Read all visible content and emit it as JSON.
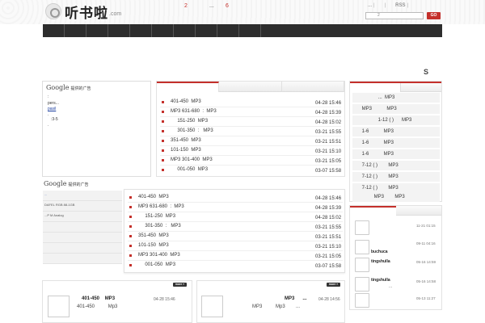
{
  "header": {
    "logo_text": "听书啦",
    "logo_sub": ".com",
    "num_a": "2",
    "dots": "...",
    "num_b": "6",
    "toplinks": [
      "...",
      "|",
      "|",
      "RSS",
      "|"
    ],
    "search_placeholder": "2",
    "search_btn": "GO"
  },
  "s_mark": "S",
  "ad1": {
    "brand": "Google",
    "title": "提供的广告",
    "lines": [
      ":",
      "pers...",
      "pasil",
      ".",
      ":3-5",
      "."
    ]
  },
  "ad2": {
    "brand": "Google",
    "title": "提供的广告",
    "bars": [
      "...",
      "DAFEL RGB 88-1GB",
      "...P M Analog",
      "",
      "",
      "",
      ""
    ]
  },
  "main_list": {
    "rows": [
      {
        "text": "401-450  MP3",
        "date": "04-28 15:46"
      },
      {
        "text": "MP3 631-680  :  MP3",
        "date": "04-28 15:39"
      },
      {
        "text": "     151-250  MP3",
        "date": "04-28 15:02"
      },
      {
        "text": "     301-350  :   MP3",
        "date": "03-21 15:55"
      },
      {
        "text": "351-450  MP3",
        "date": "03-21 15:51"
      },
      {
        "text": "101-150  MP3",
        "date": "03-21 15:10"
      },
      {
        "text": "MP3 301-400  MP3",
        "date": "03-21 15:05"
      },
      {
        "text": "     001-050  MP3",
        "date": "03-07 15:58"
      }
    ]
  },
  "second_list": {
    "rows": [
      {
        "text": "401-450  MP3",
        "date": "04-28 15:46"
      },
      {
        "text": "MP3 631-680  :  MP3",
        "date": "04-28 15:39"
      },
      {
        "text": "     151-250  MP3",
        "date": "04-28 15:02"
      },
      {
        "text": "     301-350  :   MP3",
        "date": "03-21 15:55"
      },
      {
        "text": "351-450  MP3",
        "date": "03-21 15:51"
      },
      {
        "text": "101-150  MP3",
        "date": "03-21 15:10"
      },
      {
        "text": "MP3 301-400  MP3",
        "date": "03-21 15:05"
      },
      {
        "text": "     001-050  MP3",
        "date": "03-07 15:58"
      }
    ]
  },
  "rank": {
    "items": [
      "                   ...  MP3",
      "       MP3           MP3",
      "                   1-12 ( )      MP3",
      "       1-6           MP3",
      "       1-6           MP3",
      "       1-6           MP3",
      "       7-12 ( )        MP3",
      "       7-12 ( )        MP3",
      "       7-12 ( )        MP3",
      "                MP3        MP3"
    ]
  },
  "feed": {
    "items": [
      {
        "name": "",
        "time": "11-21 01:15",
        "sub": ""
      },
      {
        "name": "buchuca",
        "time": "09-11 04:16",
        "sub": ""
      },
      {
        "name": "tingshulla",
        "time": "05-16 14:59",
        "sub": ""
      },
      {
        "name": "tingshulla",
        "time": "05-16 14:58",
        "sub": "..."
      },
      {
        "name": "",
        "time": "05-13 11:27",
        "sub": ""
      }
    ]
  },
  "cards": [
    {
      "more": "more »",
      "title": "401-450    MP3",
      "date": "04-28 15:46",
      "sub": "401-450          Mp3"
    },
    {
      "more": "more »",
      "title": "MP3      ...",
      "date": "04-28 14:56",
      "sub": "MP3          Mp3        ..."
    }
  ]
}
